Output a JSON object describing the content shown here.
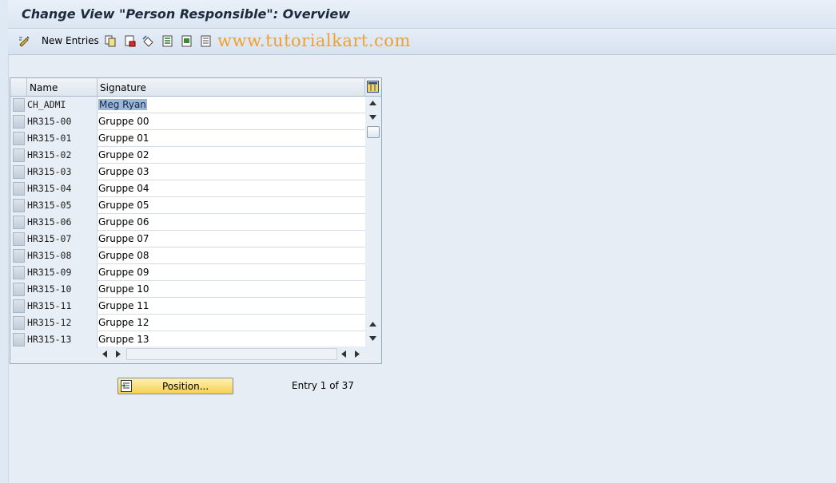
{
  "window": {
    "title": "Change View \"Person Responsible\": Overview"
  },
  "toolbar": {
    "new_entries_label": "New Entries",
    "icons": [
      "display-change-icon",
      "copy-icon",
      "delete-icon",
      "undo-icon",
      "select-all-icon",
      "select-block-icon",
      "deselect-all-icon"
    ]
  },
  "watermark": "www.tutorialkart.com",
  "table": {
    "columns": [
      "Name",
      "Signature"
    ],
    "rows": [
      {
        "name": "CH_ADMI",
        "signature": "Meg Ryan"
      },
      {
        "name": "HR315-00",
        "signature": "Gruppe 00"
      },
      {
        "name": "HR315-01",
        "signature": "Gruppe 01"
      },
      {
        "name": "HR315-02",
        "signature": "Gruppe 02"
      },
      {
        "name": "HR315-03",
        "signature": "Gruppe 03"
      },
      {
        "name": "HR315-04",
        "signature": "Gruppe 04"
      },
      {
        "name": "HR315-05",
        "signature": "Gruppe 05"
      },
      {
        "name": "HR315-06",
        "signature": "Gruppe 06"
      },
      {
        "name": "HR315-07",
        "signature": "Gruppe 07"
      },
      {
        "name": "HR315-08",
        "signature": "Gruppe 08"
      },
      {
        "name": "HR315-09",
        "signature": "Gruppe 09"
      },
      {
        "name": "HR315-10",
        "signature": "Gruppe 10"
      },
      {
        "name": "HR315-11",
        "signature": "Gruppe 11"
      },
      {
        "name": "HR315-12",
        "signature": "Gruppe 12"
      },
      {
        "name": "HR315-13",
        "signature": "Gruppe 13"
      }
    ]
  },
  "footer": {
    "position_button_label": "Position...",
    "entry_info": "Entry 1 of 37"
  }
}
